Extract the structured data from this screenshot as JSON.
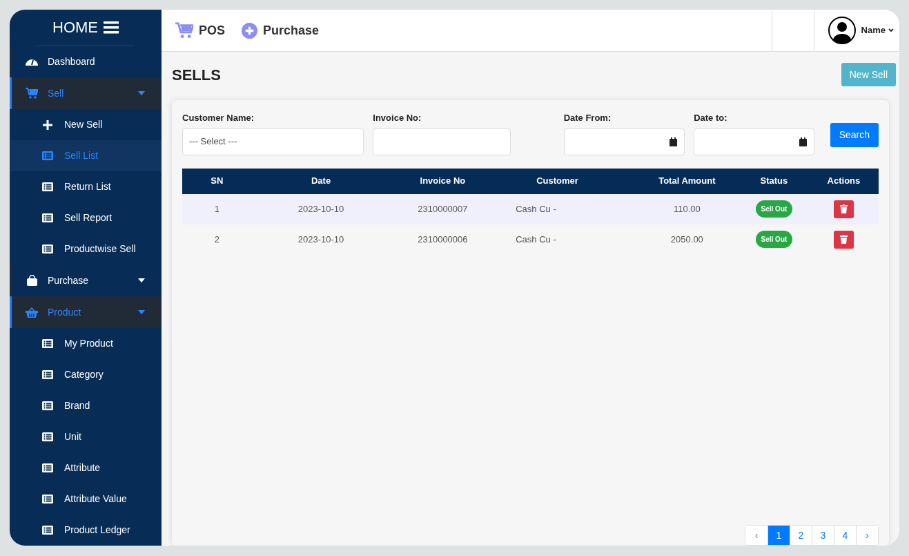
{
  "sidebar": {
    "brand": "HOME",
    "items": [
      {
        "label": "Dashboard",
        "kind": "link",
        "expanded": false
      },
      {
        "label": "Sell",
        "kind": "group",
        "expanded": true,
        "children": [
          {
            "label": "New Sell",
            "selected": false
          },
          {
            "label": "Sell List",
            "selected": true
          },
          {
            "label": "Return List",
            "selected": false
          },
          {
            "label": "Sell Report",
            "selected": false
          },
          {
            "label": "Productwise Sell",
            "selected": false
          }
        ]
      },
      {
        "label": "Purchase",
        "kind": "group",
        "expanded": false
      },
      {
        "label": "Product",
        "kind": "group",
        "expanded": true,
        "children": [
          {
            "label": "My Product",
            "selected": false
          },
          {
            "label": "Category",
            "selected": false
          },
          {
            "label": "Brand",
            "selected": false
          },
          {
            "label": "Unit",
            "selected": false
          },
          {
            "label": "Attribute",
            "selected": false
          },
          {
            "label": "Attribute Value",
            "selected": false
          },
          {
            "label": "Product Ledger",
            "selected": false
          }
        ]
      }
    ]
  },
  "topbar": {
    "links": [
      "POS",
      "Purchase"
    ],
    "user": "Name"
  },
  "page": {
    "title": "SELLS",
    "new_button": "New Sell"
  },
  "filters": {
    "customer": {
      "label": "Customer Name:",
      "value": "--- Select ---"
    },
    "invoice": {
      "label": "Invoice No:"
    },
    "date_from": {
      "label": "Date From:"
    },
    "date_to": {
      "label": "Date to:"
    },
    "search_button": "Search"
  },
  "table": {
    "columns": [
      "SN",
      "Date",
      "Invoice No",
      "Customer",
      "Total Amount",
      "Status",
      "Actions"
    ],
    "rows": [
      {
        "sn": "1",
        "date": "2023-10-10",
        "invoice": "2310000007",
        "customer": "Cash Cu -",
        "amount": "110.00",
        "status": "Sell Out"
      },
      {
        "sn": "2",
        "date": "2023-10-10",
        "invoice": "2310000006",
        "customer": "Cash Cu -",
        "amount": "2050.00",
        "status": "Sell Out"
      }
    ]
  },
  "pagination": [
    {
      "label": "‹",
      "selected": false
    },
    {
      "label": "1",
      "selected": true
    },
    {
      "label": "2",
      "selected": false
    },
    {
      "label": "3",
      "selected": false
    },
    {
      "label": "4",
      "selected": false
    },
    {
      "label": "›",
      "selected": false
    }
  ]
}
